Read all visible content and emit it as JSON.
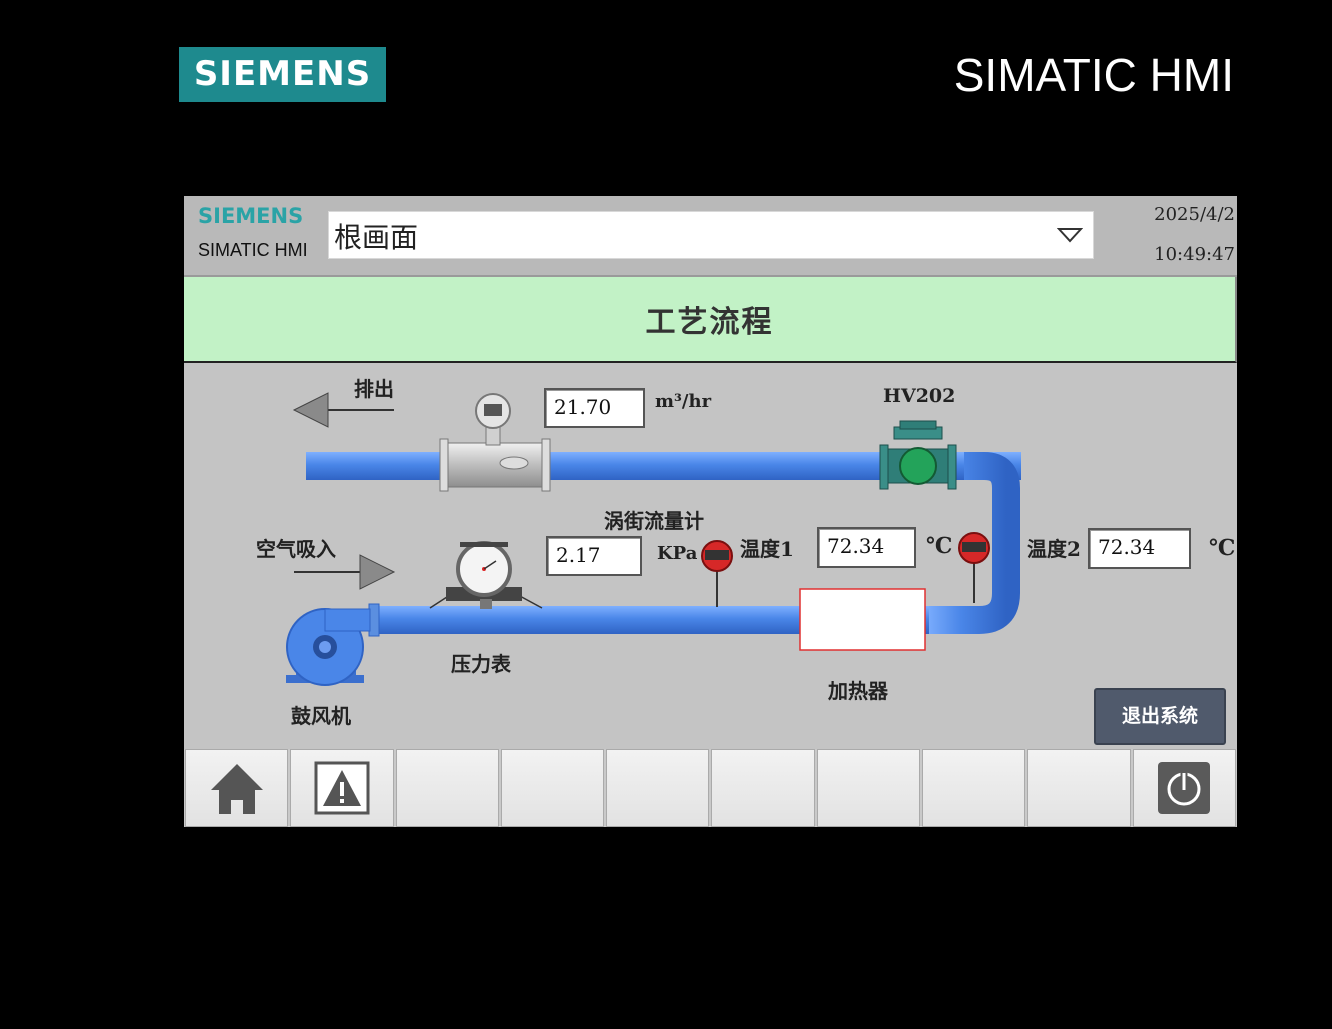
{
  "frame": {
    "brand_logo": "SIEMENS",
    "product_title": "SIMATIC HMI"
  },
  "header": {
    "brand": "SIEMENS",
    "subbrand": "SIMATIC HMI",
    "screen_selector": {
      "selected": "根画面"
    },
    "date": "2025/4/2",
    "time": "10:49:47"
  },
  "title": "工艺流程",
  "process": {
    "outlet_label": "排出",
    "inlet_label": "空气吸入",
    "flow_value": "21.70",
    "flow_unit": "m³/hr",
    "flowmeter_label": "涡街流量计",
    "valve_label": "HV202",
    "pressure_value": "2.17",
    "pressure_unit": "KPa",
    "pressure_gauge_label": "压力表",
    "temp1_label": "温度1",
    "temp1_value": "72.34",
    "temp1_unit": "℃",
    "temp2_label": "温度2",
    "temp2_value": "72.34",
    "temp2_unit": "℃",
    "heater_label": "加热器",
    "blower_label": "鼓风机"
  },
  "exit_button": "退出系统",
  "footer": {
    "keys": [
      "home-icon",
      "alarm-warning-icon",
      "",
      "",
      "",
      "",
      "",
      "",
      "",
      "power-icon"
    ]
  },
  "colors": {
    "pipe": "#4a86e8",
    "title_band": "#c2f2c6",
    "brand_teal": "#1e8a8e",
    "heater_border": "#e03030"
  }
}
